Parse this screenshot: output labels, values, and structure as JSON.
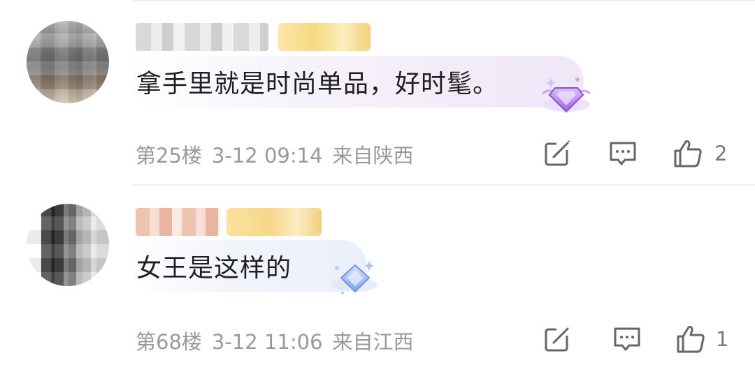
{
  "comments": [
    {
      "username": "",
      "comment_text": "拿手里就是时尚单品，好时髦。",
      "floor": "第25楼",
      "date": "3-12 09:14",
      "location": "来自陕西",
      "like_count": "2",
      "gem_color": "#b98cf0"
    },
    {
      "username": "",
      "comment_text": "女王是这样的",
      "floor": "第68楼",
      "date": "3-12 11:06",
      "location": "来自江西",
      "like_count": "1",
      "gem_color": "#8fb4f6"
    }
  ],
  "icons": {
    "repost": "repost-icon",
    "reply": "reply-icon",
    "like": "like-icon"
  }
}
